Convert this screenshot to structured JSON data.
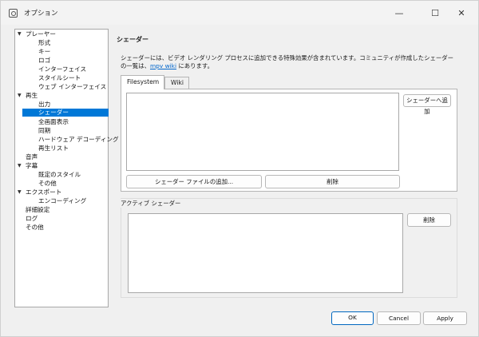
{
  "window": {
    "title": "オプション",
    "minimize": "—",
    "maximize": "☐",
    "close": "✕"
  },
  "tree": {
    "items": [
      {
        "label": "プレーヤー",
        "expanded": true
      },
      {
        "label": "形式"
      },
      {
        "label": "キー"
      },
      {
        "label": "ロゴ"
      },
      {
        "label": "インターフェイス"
      },
      {
        "label": "スタイルシート"
      },
      {
        "label": "ウェブ インターフェイス"
      },
      {
        "label": "再生",
        "expanded": true
      },
      {
        "label": "出力"
      },
      {
        "label": "シェーダー",
        "selected": true
      },
      {
        "label": "全画面表示"
      },
      {
        "label": "同期"
      },
      {
        "label": "ハードウェア デコーディング"
      },
      {
        "label": "再生リスト"
      },
      {
        "label": "音声"
      },
      {
        "label": "字幕",
        "expanded": true
      },
      {
        "label": "既定のスタイル"
      },
      {
        "label": "その他"
      },
      {
        "label": "エクスポート",
        "expanded": true
      },
      {
        "label": "エンコーディング"
      },
      {
        "label": "詳細設定"
      },
      {
        "label": "ログ"
      },
      {
        "label": "その他"
      }
    ]
  },
  "main": {
    "title": "シェーダー",
    "description_before": "シェーダーには、ビデオ レンダリング プロセスに追加できる特殊効果が含まれています。コミュニティが作成したシェーダーの一覧は、",
    "description_link": "mpv wiki",
    "description_after": " にあります。",
    "tabs": [
      {
        "label": "Filesystem",
        "active": true
      },
      {
        "label": "Wiki",
        "active": false
      }
    ],
    "add_to_shader_button": "シェーダーへ追加",
    "add_shader_file_button": "シェーダー ファイルの追加...",
    "delete_button": "削除",
    "active_group_label": "アクティブ シェーダー",
    "active_delete_button": "削除"
  },
  "footer": {
    "ok": "OK",
    "cancel": "Cancel",
    "apply": "Apply"
  },
  "colors": {
    "accent": "#0078d7",
    "link": "#0066cc"
  }
}
